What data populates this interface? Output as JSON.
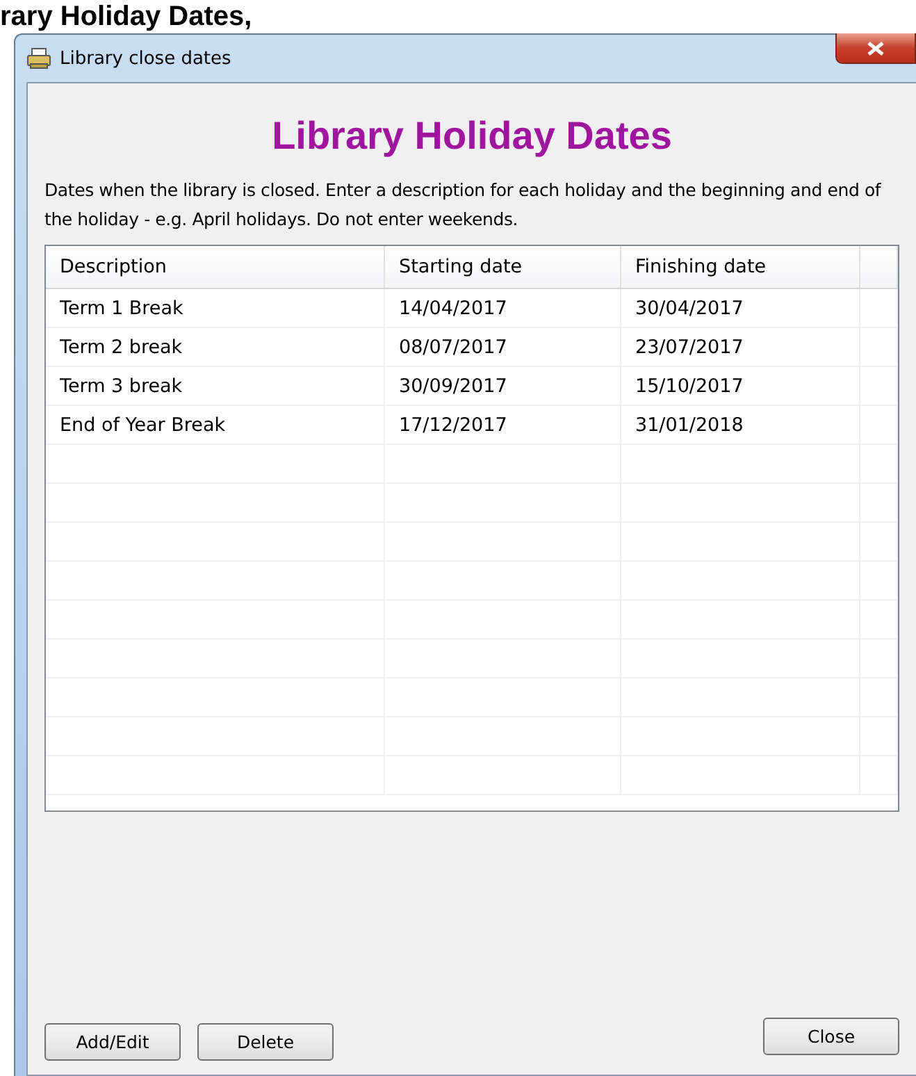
{
  "page_heading": "rary Holiday Dates,",
  "window": {
    "title": "Library close dates"
  },
  "heading": "Library Holiday Dates",
  "description": "Dates when the library is closed. Enter a description for each holiday and the beginning and end of the holiday - e.g. April holidays. Do not enter weekends.",
  "table": {
    "columns": [
      "Description",
      "Starting date",
      "Finishing date"
    ],
    "rows": [
      [
        "Term 1 Break",
        "14/04/2017",
        "30/04/2017"
      ],
      [
        "Term 2 break",
        "08/07/2017",
        "23/07/2017"
      ],
      [
        "Term 3 break",
        "30/09/2017",
        "15/10/2017"
      ],
      [
        "End of Year Break",
        "17/12/2017",
        "31/01/2018"
      ]
    ]
  },
  "buttons_left": [
    "Add/Edit",
    "Delete"
  ],
  "button_right": "Close"
}
